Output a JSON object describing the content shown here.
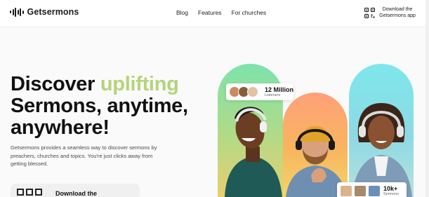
{
  "brand": {
    "name": "Getsermons"
  },
  "nav": {
    "items": [
      "Blog",
      "Features",
      "For churches"
    ]
  },
  "download_app": {
    "label": "Download the Getsermons app",
    "icon": "qr-code-icon"
  },
  "hero": {
    "headline_line1_before": "Discover ",
    "headline_accent": "uplifting",
    "headline_line2": "Sermons, anytime,",
    "headline_line3": "anywhere!",
    "description": "Getsermons provides a seamless way to discover sermons by preachers, churches and topics. You're just clicks away from getting blessed.",
    "download_card_label": "Download the"
  },
  "stats": {
    "listeners_value": "12 Million",
    "listeners_label": "Listeners",
    "sermons_value": "10k+",
    "sermons_label": "Sermons"
  },
  "colors": {
    "accent": "#b6d47a",
    "pill_green": "#7de3ac",
    "pill_orange": "#ffa07a",
    "pill_cyan": "#7ee7ec"
  }
}
